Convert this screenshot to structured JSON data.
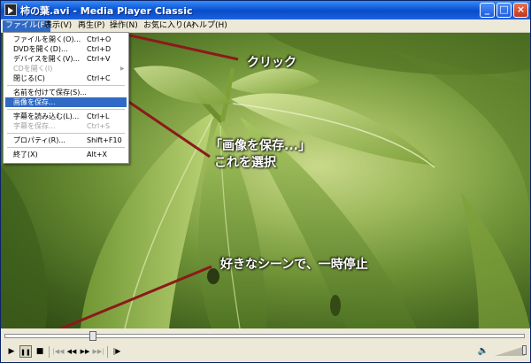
{
  "window": {
    "title": "柿の葉.avi - Media Player Classic",
    "minimize_glyph": "_",
    "maximize_glyph": "□",
    "close_glyph": "×"
  },
  "menubar": {
    "items": [
      {
        "label": "ファイル(F)",
        "active": true
      },
      {
        "label": "表示(V)"
      },
      {
        "label": "再生(P)"
      },
      {
        "label": "操作(N)"
      },
      {
        "label": "お気に入り(A)"
      },
      {
        "label": "ヘルプ(H)"
      }
    ]
  },
  "file_menu": {
    "items": [
      {
        "label": "ファイルを開く(O)...",
        "shortcut": "Ctrl+O"
      },
      {
        "label": "DVDを開く(D)...",
        "shortcut": "Ctrl+D"
      },
      {
        "label": "デバイスを開く(V)...",
        "shortcut": "Ctrl+V"
      },
      {
        "label": "CDを開く(I)",
        "shortcut": "",
        "disabled": true
      },
      {
        "label": "閉じる(C)",
        "shortcut": "Ctrl+C"
      },
      {
        "label": "名前を付けて保存(S)...",
        "shortcut": ""
      },
      {
        "label": "画像を保存...",
        "shortcut": "",
        "highlighted": true
      },
      {
        "label": "字幕を読み込む(L)...",
        "shortcut": "Ctrl+L"
      },
      {
        "label": "字幕を保存...",
        "shortcut": "Ctrl+S",
        "disabled": true
      },
      {
        "label": "プロパティ(R)...",
        "shortcut": "Shift+F10"
      },
      {
        "label": "終了(X)",
        "shortcut": "Alt+X"
      }
    ]
  },
  "annotations": {
    "click": "クリック",
    "select_line1": "「画像を保存...」",
    "select_line2": "これを選択",
    "pause": "好きなシーンで、一時停止"
  },
  "annotation_color": "#8b1a1a",
  "playback": {
    "seek_position": 0.17,
    "volume_level": 1.0
  },
  "controls": {
    "play_icon": "▶",
    "pause_icon": "❚❚",
    "stop_icon": "■",
    "skip_back_icon": "|◀◀",
    "rewind_icon": "◀◀",
    "fast_forward_icon": "▶▶",
    "skip_forward_icon": "▶▶|",
    "frame_step_icon": "|▶",
    "speaker_icon": "🔈"
  }
}
